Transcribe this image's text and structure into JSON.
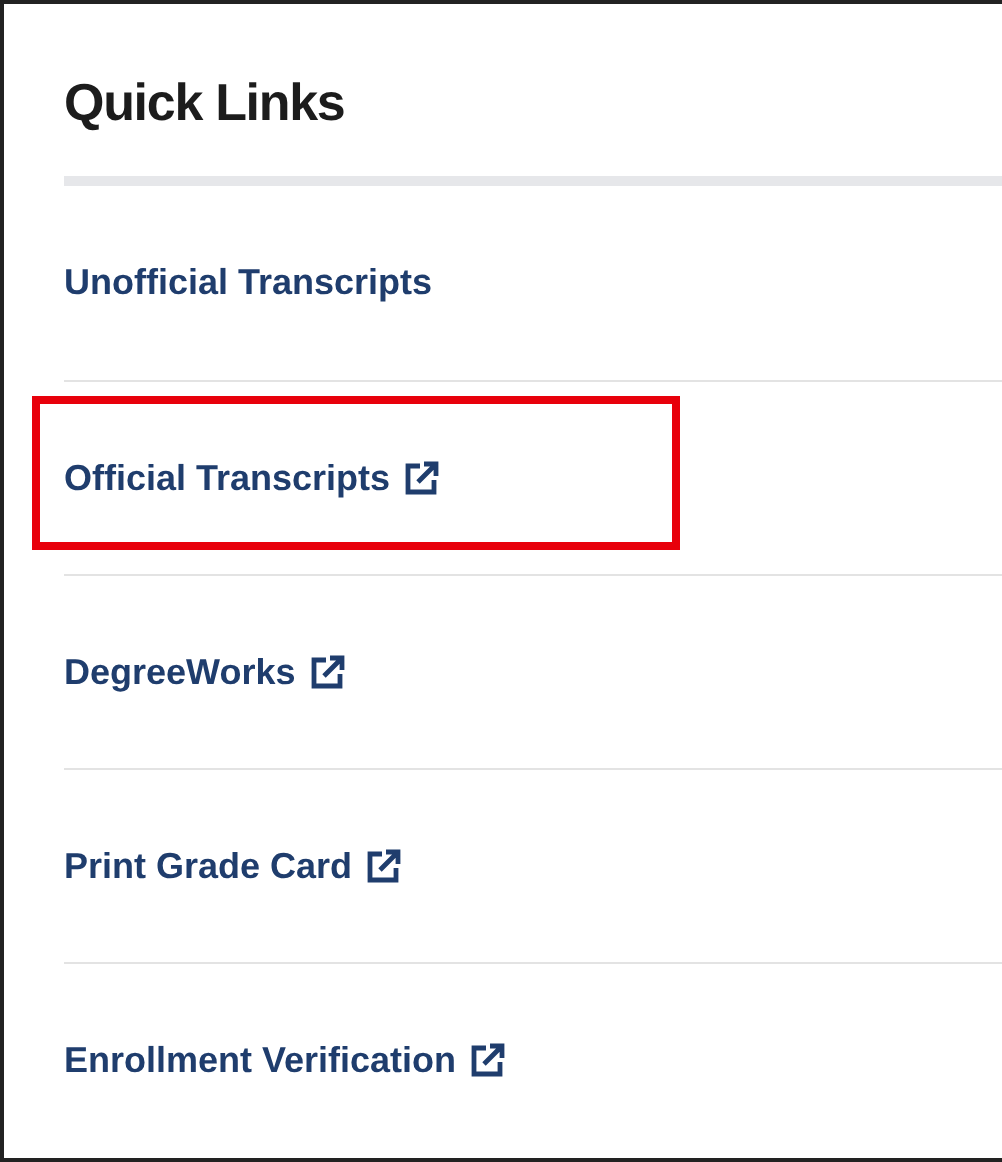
{
  "title": "Quick Links",
  "links": [
    {
      "label": "Unofficial Transcripts",
      "external": false,
      "highlighted": false
    },
    {
      "label": "Official Transcripts",
      "external": true,
      "highlighted": true
    },
    {
      "label": "DegreeWorks",
      "external": true,
      "highlighted": false
    },
    {
      "label": "Print Grade Card",
      "external": true,
      "highlighted": false
    },
    {
      "label": "Enrollment Verification",
      "external": true,
      "highlighted": false
    }
  ]
}
